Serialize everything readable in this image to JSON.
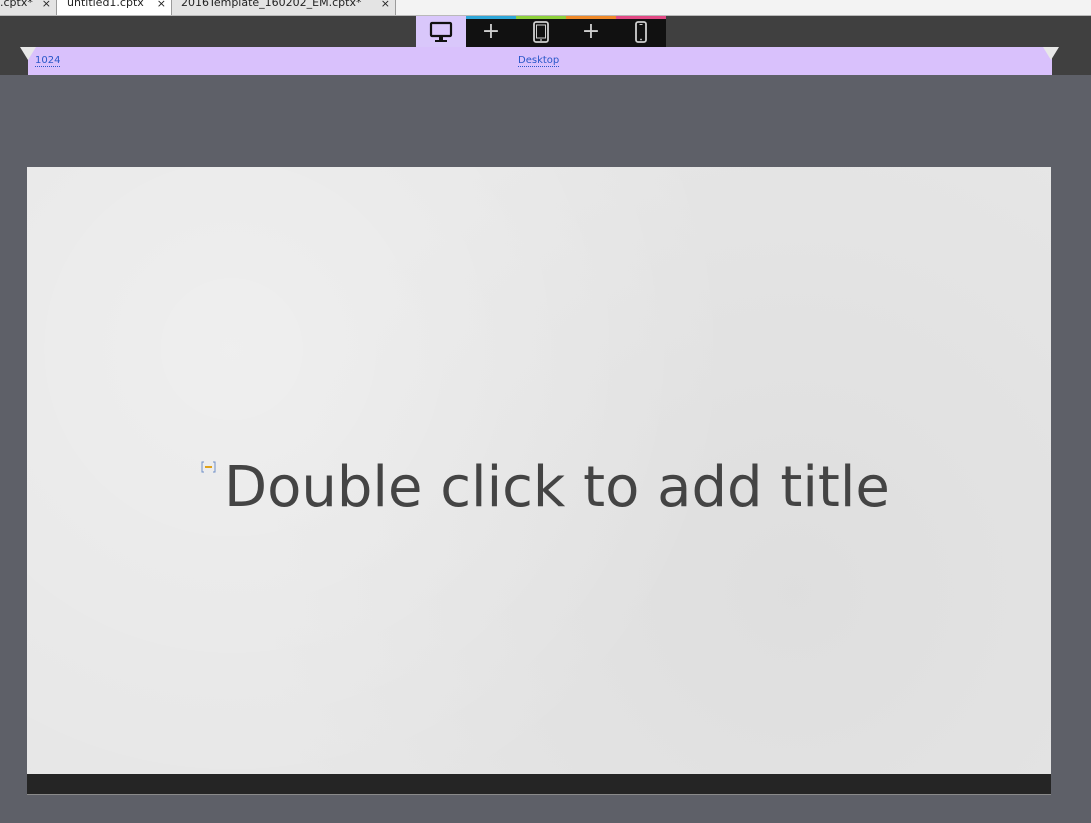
{
  "tabs": [
    {
      "label": ".cptx*",
      "close": "×",
      "active": false
    },
    {
      "label": "untitled1.cptx",
      "close": "×",
      "active": true
    },
    {
      "label": "2016Template_160202_EM.cptx*",
      "close": "×",
      "active": false
    }
  ],
  "breakpoints": [
    {
      "icon": "desktop-icon",
      "active": true,
      "accent": "#d9c7fb"
    },
    {
      "icon": "plus-icon",
      "symbol": "+",
      "accent": "#2fa7d9"
    },
    {
      "icon": "tablet-icon",
      "accent": "#8ed13c"
    },
    {
      "icon": "plus-icon",
      "symbol": "+",
      "accent": "#f08a2a"
    },
    {
      "icon": "mobile-icon",
      "accent": "#e24a86"
    }
  ],
  "ruler": {
    "width_value": "1024",
    "mode_label": "Desktop"
  },
  "slide": {
    "title_placeholder": "Double click to add title"
  },
  "colors": {
    "workspace": "#5e6068",
    "ruler_fill": "#d9c1fc",
    "slide_background": "#e6e6e6",
    "title_text": "#444444"
  }
}
